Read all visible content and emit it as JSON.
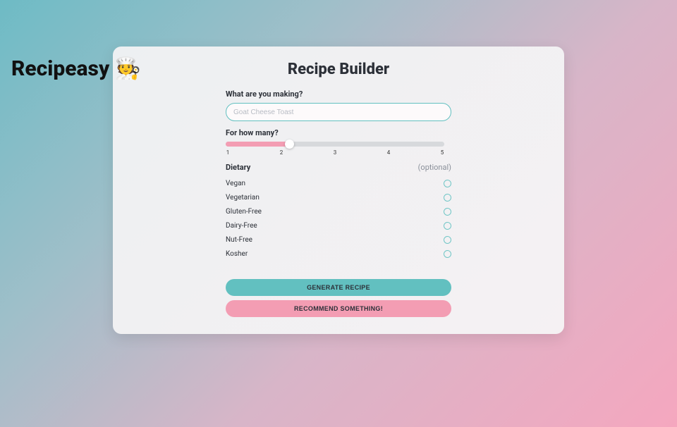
{
  "app": {
    "title": "Recipeasy 🧑‍🍳"
  },
  "card": {
    "title": "Recipe Builder"
  },
  "form": {
    "making": {
      "label": "What are you making?",
      "placeholder": "Goat Cheese Toast",
      "value": ""
    },
    "servings": {
      "label": "For how many?",
      "min": 1,
      "max": 5,
      "value": 2,
      "ticks": [
        "1",
        "2",
        "3",
        "4",
        "5"
      ]
    },
    "dietary": {
      "label": "Dietary",
      "optional_label": "(optional)",
      "options": [
        {
          "label": "Vegan",
          "checked": false
        },
        {
          "label": "Vegetarian",
          "checked": false
        },
        {
          "label": "Gluten-Free",
          "checked": false
        },
        {
          "label": "Dairy-Free",
          "checked": false
        },
        {
          "label": "Nut-Free",
          "checked": false
        },
        {
          "label": "Kosher",
          "checked": false
        }
      ]
    },
    "buttons": {
      "generate": "GENERATE RECIPE",
      "recommend": "RECOMMEND SOMETHING!"
    }
  }
}
